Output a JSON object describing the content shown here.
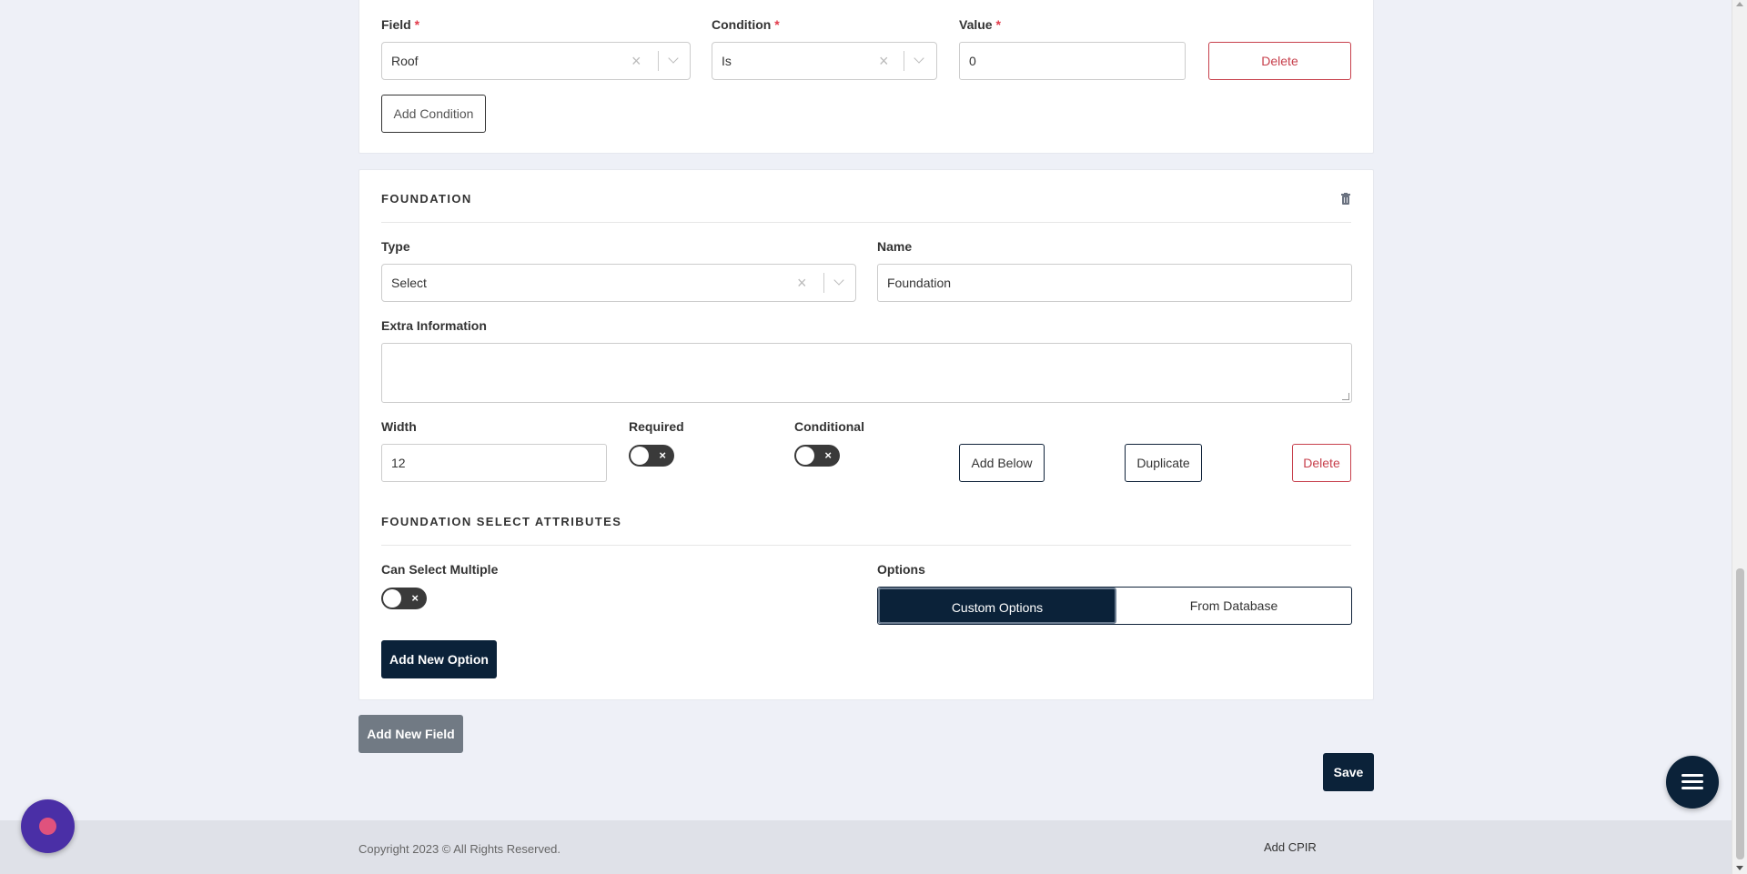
{
  "condition_row": {
    "field_label": "Field",
    "field_value": "Roof",
    "condition_label": "Condition",
    "condition_value": "Is",
    "value_label": "Value",
    "value_value": "0",
    "required_mark": "*",
    "delete_label": "Delete",
    "add_condition_label": "Add Condition"
  },
  "foundation": {
    "section_title": "FOUNDATION",
    "type_label": "Type",
    "type_value": "Select",
    "name_label": "Name",
    "name_value": "Foundation",
    "extra_info_label": "Extra Information",
    "extra_info_value": "",
    "width_label": "Width",
    "width_value": "12",
    "required_label": "Required",
    "required_on": false,
    "conditional_label": "Conditional",
    "conditional_on": false,
    "add_below_label": "Add Below",
    "duplicate_label": "Duplicate",
    "delete_label": "Delete",
    "attributes_title": "FOUNDATION SELECT ATTRIBUTES",
    "can_select_multiple_label": "Can Select Multiple",
    "can_select_multiple_on": false,
    "options_label": "Options",
    "options_choices": [
      "Custom Options",
      "From Database"
    ],
    "options_selected": "Custom Options",
    "add_new_option_label": "Add New Option"
  },
  "actions": {
    "add_new_field_label": "Add New Field",
    "save_label": "Save"
  },
  "footer": {
    "copyright": "Copyright 2023 © All Rights Reserved.",
    "add_cpir_link": "Add CPIR"
  },
  "icons": {
    "toggle_off": "×",
    "clear": "×"
  },
  "colors": {
    "primary": "#0b2239",
    "danger": "#c7404c",
    "required": "#e23b4b",
    "background": "#eef0f7",
    "chat_widget": "#4a2fa6"
  }
}
